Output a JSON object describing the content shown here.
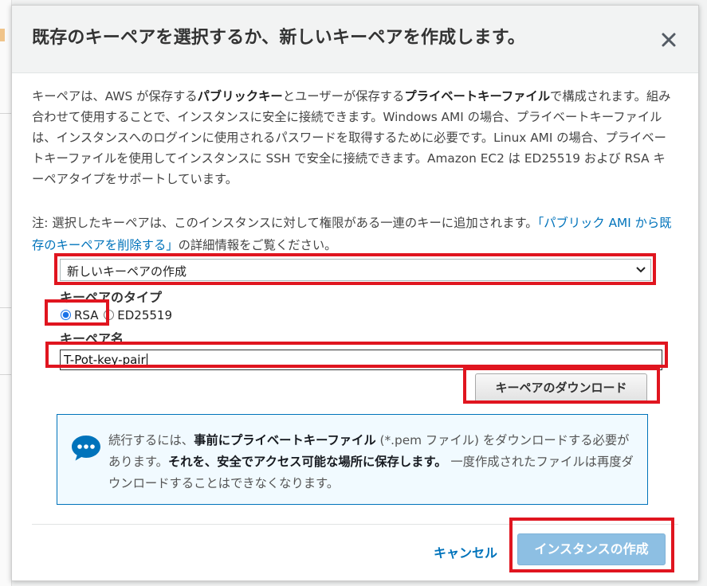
{
  "dialog": {
    "title": "既存のキーペアを選択するか、新しいキーペアを作成します。",
    "close_label": "×"
  },
  "description": {
    "p1_a": "キーペアは、AWS が保存する",
    "p1_b": "パブリックキー",
    "p1_c": "とユーザーが保存する",
    "p1_d": "プライベートキーファイル",
    "p1_e": "で構成されます。組み合わせて使用することで、インスタンスに安全に接続できます。Windows AMI の場合、プライベートキーファイルは、インスタンスへのログインに使用されるパスワードを取得するために必要です。Linux AMI の場合、プライベートキーファイルを使用してインスタンスに SSH で安全に接続できます。Amazon EC2 は ED25519 および RSA キーペアタイプをサポートしています。"
  },
  "note": {
    "prefix": "注: 選択したキーペアは、このインスタンスに対して権限がある一連のキーに追加されます。",
    "link": "「パブリック AMI から既存のキーペアを削除する」",
    "suffix": "の詳細情報をご覧ください。"
  },
  "keypair_select": {
    "selected": "新しいキーペアの作成"
  },
  "keypair_type": {
    "label": "キーペアのタイプ",
    "options": [
      {
        "label": "RSA",
        "checked": true
      },
      {
        "label": "ED25519",
        "checked": false
      }
    ]
  },
  "keypair_name": {
    "label": "キーペア名",
    "value": "T-Pot-key-pair"
  },
  "download_button": {
    "label": "キーペアのダウンロード"
  },
  "info": {
    "t1": "続行するには、",
    "t2": "事前にプライベートキーファイル",
    "t3": " (*.pem ファイル) をダウンロードする必要があります。",
    "t4": "それを、安全でアクセス可能な場所に保存します。",
    "t5": " 一度作成されたファイルは再度ダウンロードすることはできなくなります。"
  },
  "footer": {
    "cancel_label": "キャンセル",
    "launch_label": "インスタンスの作成"
  },
  "colors": {
    "link": "#0073bb",
    "primary_disabled": "#8dbfe3",
    "highlight": "#e0151f",
    "info_bg": "#f1faff"
  },
  "icons": [
    "close-icon",
    "chevron-down-icon",
    "chat-bubble-icon"
  ]
}
